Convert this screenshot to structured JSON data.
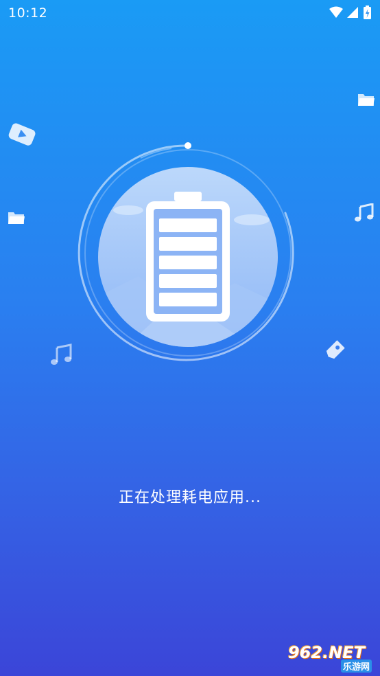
{
  "status_bar": {
    "time": "10:12",
    "icons": [
      "wifi-icon",
      "signal-icon",
      "battery-charging-icon"
    ]
  },
  "main": {
    "message": "正在处理耗电应用...",
    "center_icon": "battery-icon",
    "floating_icons": [
      "video-icon",
      "folder-icon",
      "folder-icon",
      "music-note-icon",
      "music-note-icon",
      "tag-icon"
    ]
  },
  "watermark": {
    "brand": "962.NET",
    "subtitle": "乐游网"
  },
  "colors": {
    "background_top": "#1a9bf5",
    "background_bottom": "#3b45d8",
    "text": "#ffffff"
  }
}
